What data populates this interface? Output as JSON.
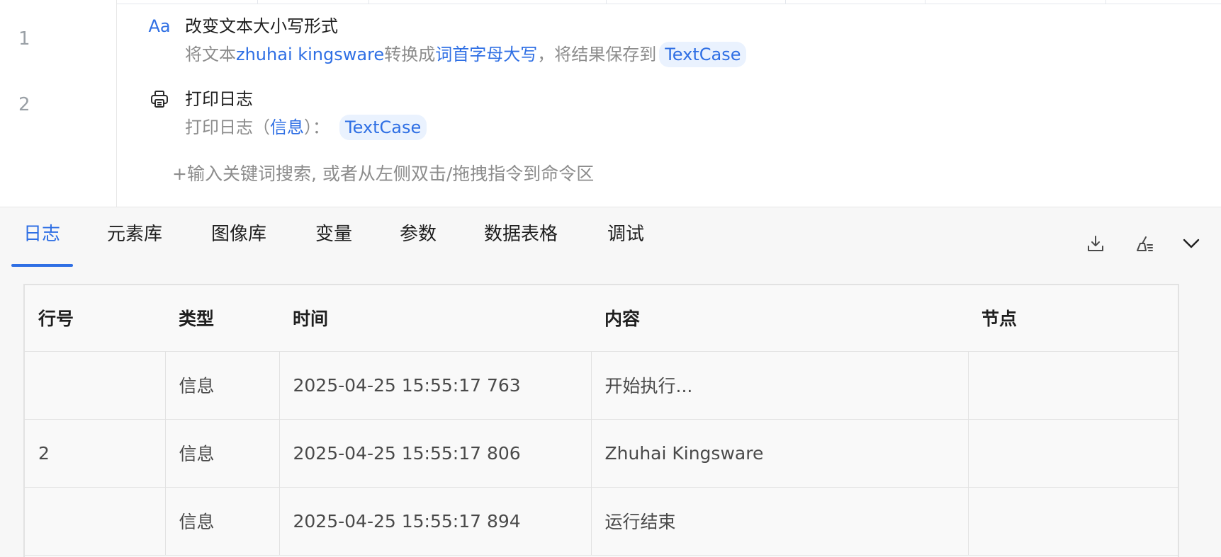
{
  "editor": {
    "line_numbers": [
      "1",
      "2"
    ],
    "commands": [
      {
        "icon": "text-case-icon",
        "icon_text": "Aa",
        "title": "改变文本大小写形式",
        "desc_prefix": "将文本",
        "desc_text_value": "zhuhai kingsware",
        "desc_mid": "转换成",
        "desc_case": "词首字母大写",
        "desc_suffix": "，将结果保存到",
        "desc_var": "TextCase"
      },
      {
        "icon": "printer-icon",
        "title": "打印日志",
        "desc_prefix": "打印日志（",
        "desc_level": "信息",
        "desc_suffix": "）：",
        "desc_var": "TextCase"
      }
    ],
    "add_hint": "+输入关键词搜索, 或者从左侧双击/拖拽指令到命令区"
  },
  "panel": {
    "tabs": [
      {
        "label": "日志",
        "active": true
      },
      {
        "label": "元素库",
        "active": false
      },
      {
        "label": "图像库",
        "active": false
      },
      {
        "label": "变量",
        "active": false
      },
      {
        "label": "参数",
        "active": false
      },
      {
        "label": "数据表格",
        "active": false
      },
      {
        "label": "调试",
        "active": false
      }
    ],
    "tools": [
      "download-icon",
      "clear-icon",
      "chevron-down-icon"
    ],
    "accent_color": "#2f6fe4"
  },
  "log_table": {
    "columns": [
      "行号",
      "类型",
      "时间",
      "内容",
      "节点"
    ],
    "rows": [
      {
        "line": "",
        "type": "信息",
        "time": "2025-04-25 15:55:17 763",
        "content": "开始执行...",
        "node": ""
      },
      {
        "line": "2",
        "type": "信息",
        "time": "2025-04-25 15:55:17 806",
        "content": "Zhuhai Kingsware",
        "node": ""
      },
      {
        "line": "",
        "type": "信息",
        "time": "2025-04-25 15:55:17 894",
        "content": "运行结束",
        "node": ""
      }
    ]
  }
}
